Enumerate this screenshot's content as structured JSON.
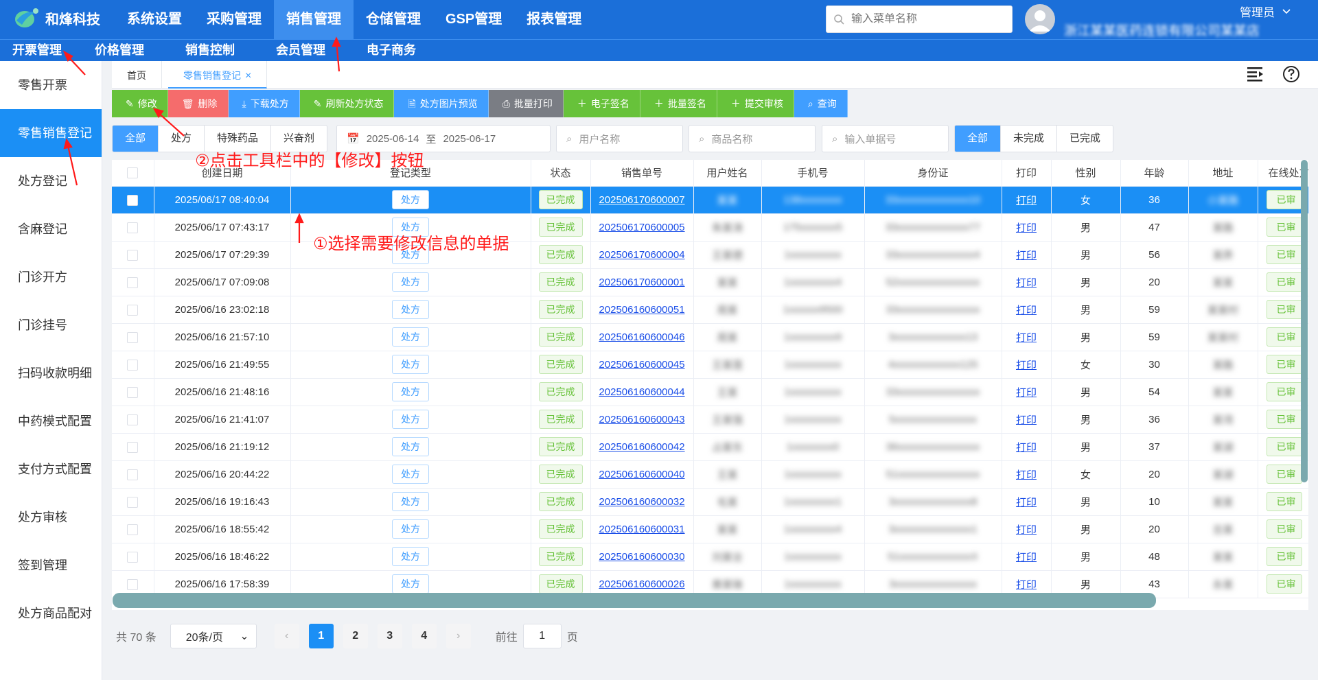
{
  "app": {
    "name": "和烽科技"
  },
  "topnav": [
    "系统设置",
    "采购管理",
    "销售管理",
    "仓储管理",
    "GSP管理",
    "报表管理"
  ],
  "search": {
    "placeholder": "输入菜单名称"
  },
  "user": {
    "role": "管理员",
    "org": "浙江某某医药连锁有限公司某某店"
  },
  "subnav": [
    "开票管理",
    "价格管理",
    "销售控制",
    "会员管理",
    "电子商务"
  ],
  "sidebar": [
    "零售开票",
    "零售销售登记",
    "处方登记",
    "含麻登记",
    "门诊开方",
    "门诊挂号",
    "扫码收款明细",
    "中药模式配置",
    "支付方式配置",
    "处方审核",
    "签到管理",
    "处方商品配对"
  ],
  "tabs": {
    "home": "首页",
    "current": "零售销售登记",
    "close": "×"
  },
  "toolbar": [
    "修改",
    "删除",
    "下载处方",
    "刷新处方状态",
    "处方图片预览",
    "批量打印",
    "电子签名",
    "批量签名",
    "提交审核",
    "查询"
  ],
  "filters": {
    "reg_type": [
      "全部",
      "处方",
      "特殊药品",
      "兴奋剂"
    ],
    "date_from": "2025-06-14",
    "date_sep": "至",
    "date_to": "2025-06-17",
    "user_placeholder": "用户名称",
    "product_placeholder": "商品名称",
    "bill_placeholder": "输入单据号",
    "status": [
      "全部",
      "未完成",
      "已完成"
    ]
  },
  "annotations": {
    "step2": "②点击工具栏中的【修改】按钮",
    "step1": "①选择需要修改信息的单据"
  },
  "table": {
    "headers": [
      "",
      "创建日期",
      "登记类型",
      "状态",
      "销售单号",
      "用户姓名",
      "手机号",
      "身份证",
      "打印",
      "性别",
      "年龄",
      "地址",
      "在线处方"
    ],
    "rows": [
      {
        "date": "2025/06/17 08:40:04",
        "type": "处方",
        "status": "已完成",
        "no": "202506170600007",
        "name": "某某",
        "phone": "138xxxxxxxx",
        "id": "33xxxxxxxxxxxxxx10",
        "print": "打印",
        "sex": "女",
        "age": "36",
        "addr": "小某路",
        "rx": "已审"
      },
      {
        "date": "2025/06/17 07:43:17",
        "type": "处方",
        "status": "已完成",
        "no": "202506170600005",
        "name": "朱某涛",
        "phone": "175xxxxxxx5",
        "id": "33xxxxxxxxxxxxxx77",
        "print": "打印",
        "sex": "男",
        "age": "47",
        "addr": "某路",
        "rx": "已审"
      },
      {
        "date": "2025/06/17 07:29:39",
        "type": "处方",
        "status": "已完成",
        "no": "202506170600004",
        "name": "王某德",
        "phone": "1xxxxxxxxxx",
        "id": "33xxxxxxxxxxxxxxx4",
        "print": "打印",
        "sex": "男",
        "age": "56",
        "addr": "某弄",
        "rx": "已审"
      },
      {
        "date": "2025/06/17 07:09:08",
        "type": "处方",
        "status": "已完成",
        "no": "202506170600001",
        "name": "某某",
        "phone": "1xxxxxxxxx4",
        "id": "52xxxxxxxxxxxxxxxx",
        "print": "打印",
        "sex": "男",
        "age": "20",
        "addr": "某某",
        "rx": "已审"
      },
      {
        "date": "2025/06/16 23:02:18",
        "type": "处方",
        "status": "已完成",
        "no": "202506160600051",
        "name": "周某",
        "phone": "1xxxxxx9500",
        "id": "33xxxxxxxxxxxxxxxx",
        "print": "打印",
        "sex": "男",
        "age": "59",
        "addr": "某某村",
        "rx": "已审"
      },
      {
        "date": "2025/06/16 21:57:10",
        "type": "处方",
        "status": "已完成",
        "no": "202506160600046",
        "name": "周某",
        "phone": "1xxxxxxxxx9",
        "id": "3xxxxxxxxxxxxxx13",
        "print": "打印",
        "sex": "男",
        "age": "59",
        "addr": "某某村",
        "rx": "已审"
      },
      {
        "date": "2025/06/16 21:49:55",
        "type": "处方",
        "status": "已完成",
        "no": "202506160600045",
        "name": "王某莲",
        "phone": "1xxxxxxxxxx",
        "id": "4xxxxxxxxxxxxx125",
        "print": "打印",
        "sex": "女",
        "age": "30",
        "addr": "某路",
        "rx": "已审"
      },
      {
        "date": "2025/06/16 21:48:16",
        "type": "处方",
        "status": "已完成",
        "no": "202506160600044",
        "name": "王某",
        "phone": "1xxxxxxxxxx",
        "id": "33xxxxxxxxxxxxxxxx",
        "print": "打印",
        "sex": "男",
        "age": "54",
        "addr": "某某",
        "rx": "已审"
      },
      {
        "date": "2025/06/16 21:41:07",
        "type": "处方",
        "status": "已完成",
        "no": "202506160600043",
        "name": "王某强",
        "phone": "1xxxxxxxxxx",
        "id": "5xxxxxxxxxxxxxxxx",
        "print": "打印",
        "sex": "男",
        "age": "36",
        "addr": "某湾",
        "rx": "已审"
      },
      {
        "date": "2025/06/16 21:19:12",
        "type": "处方",
        "status": "已完成",
        "no": "202506160600042",
        "name": "占某东",
        "phone": "1xxxxxxxx0",
        "id": "36xxxxxxxxxxxxxxxx",
        "print": "打印",
        "sex": "男",
        "age": "37",
        "addr": "某湖",
        "rx": "已审"
      },
      {
        "date": "2025/06/16 20:44:22",
        "type": "处方",
        "status": "已完成",
        "no": "202506160600040",
        "name": "王某",
        "phone": "1xxxxxxxxxx",
        "id": "51xxxxxxxxxxxxxxxx",
        "print": "打印",
        "sex": "女",
        "age": "20",
        "addr": "某湖",
        "rx": "已审"
      },
      {
        "date": "2025/06/16 19:16:43",
        "type": "处方",
        "status": "已完成",
        "no": "202506160600032",
        "name": "毛某",
        "phone": "1xxxxxxxxx1",
        "id": "3xxxxxxxxxxxxxxx8",
        "print": "打印",
        "sex": "男",
        "age": "10",
        "addr": "某某",
        "rx": "已审"
      },
      {
        "date": "2025/06/16 18:55:42",
        "type": "处方",
        "status": "已完成",
        "no": "202506160600031",
        "name": "某某",
        "phone": "1xxxxxxxxx4",
        "id": "3xxxxxxxxxxxxxxx1",
        "print": "打印",
        "sex": "男",
        "age": "20",
        "addr": "吉某",
        "rx": "已审"
      },
      {
        "date": "2025/06/16 18:46:22",
        "type": "处方",
        "status": "已完成",
        "no": "202506160600030",
        "name": "刘某全",
        "phone": "1xxxxxxxxxx",
        "id": "51xxxxxxxxxxxxxxX",
        "print": "打印",
        "sex": "男",
        "age": "48",
        "addr": "某某",
        "rx": "已审"
      },
      {
        "date": "2025/06/16 17:58:39",
        "type": "处方",
        "status": "已完成",
        "no": "202506160600026",
        "name": "黄某锋",
        "phone": "1xxxxxxxxxx",
        "id": "3xxxxxxxxxxxxxxxx",
        "print": "打印",
        "sex": "男",
        "age": "43",
        "addr": "永某",
        "rx": "已审"
      }
    ]
  },
  "pager": {
    "total": "共 70 条",
    "size": "20条/页",
    "pages": [
      "1",
      "2",
      "3",
      "4"
    ],
    "goto_pre": "前往",
    "goto_val": "1",
    "goto_post": "页"
  },
  "colors": {
    "brand": "#1b6fd9",
    "primary": "#409eff",
    "success": "#67c23a",
    "danger": "#f56c6c",
    "annotation": "#ff1a1a"
  }
}
